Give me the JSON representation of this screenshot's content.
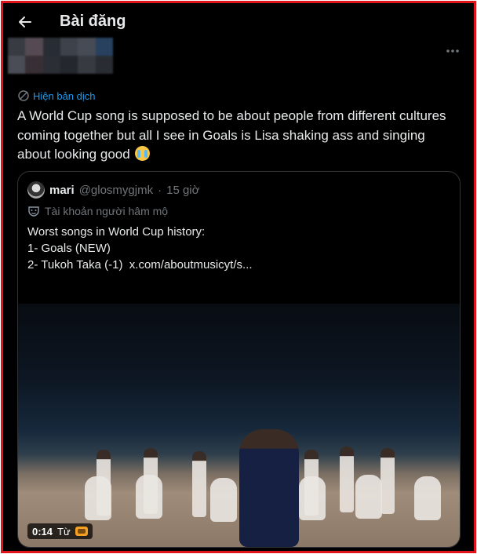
{
  "header": {
    "title": "Bài đăng"
  },
  "post": {
    "translate_label": "Hiện bản dịch",
    "text": "A World Cup song is supposed to be about people from different cultures coming together but all I see in Goals is Lisa shaking ass and singing about looking good",
    "emoji": "loudly-crying-face"
  },
  "quote": {
    "name": "mari",
    "handle": "@glosmygjmk",
    "separator": "·",
    "time": "15 giờ",
    "account_label": "Tài khoản người hâm mộ",
    "lines": [
      "Worst songs in World Cup history:",
      "",
      "1- Goals (NEW)",
      "2- Tukoh Taka (-1)  x.com/aboutmusicyt/s..."
    ]
  },
  "video": {
    "timestamp": "0:14",
    "source_label": "Từ"
  },
  "colors": {
    "background": "#000000",
    "text": "#e7e9ea",
    "muted": "#71767b",
    "link": "#1d9bf0",
    "border": "#2f3336",
    "frame": "#e0141b"
  }
}
